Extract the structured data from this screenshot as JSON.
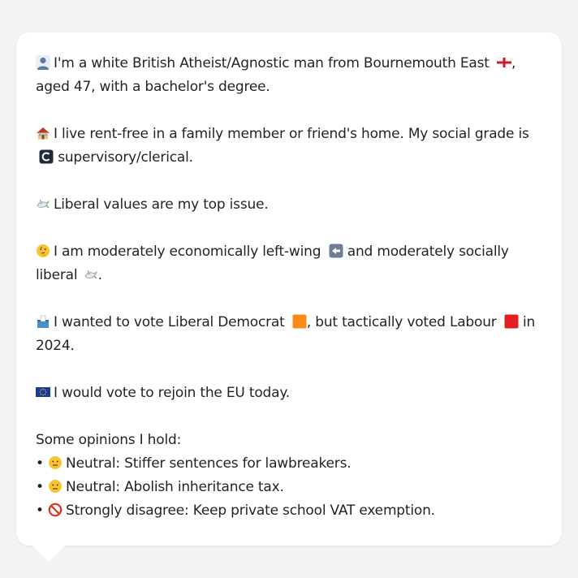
{
  "profile": {
    "identity": {
      "text": "I'm a white British Atheist/Agnostic man from Bournemouth East",
      "after_flag": ", aged 47, with a bachelor's degree."
    },
    "housing": {
      "text": "I live rent-free in a family member or friend's home. My social grade is",
      "after_icon": " supervisory/clerical."
    },
    "top_issue": {
      "text": "Liberal values are my top issue."
    },
    "ideology": {
      "text": "I am moderately economically left-wing",
      "middle": " and moderately socially liberal",
      "end": "."
    },
    "vote": {
      "text": "I wanted to vote Liberal Democrat",
      "middle": ", but tactically voted Labour",
      "end": " in 2024."
    },
    "eu": {
      "text": "I would vote to rejoin the EU today."
    },
    "opinions": {
      "heading": "Some opinions I hold:",
      "items": [
        {
          "bullet": "•",
          "text": "Neutral: Stiffer sentences for lawbreakers.",
          "icon": "neutral-face-icon"
        },
        {
          "bullet": "•",
          "text": "Neutral: Abolish inheritance tax.",
          "icon": "neutral-face-icon"
        },
        {
          "bullet": "•",
          "text": "Strongly disagree: Keep private school VAT exemption.",
          "icon": "no-entry-icon"
        }
      ]
    }
  },
  "colors": {
    "background": "#f2f3f5",
    "card": "#ffffff",
    "text": "#1f2328",
    "libdem": "#fa8c16",
    "labour": "#e02020",
    "eu_blue": "#1a3a9a"
  }
}
